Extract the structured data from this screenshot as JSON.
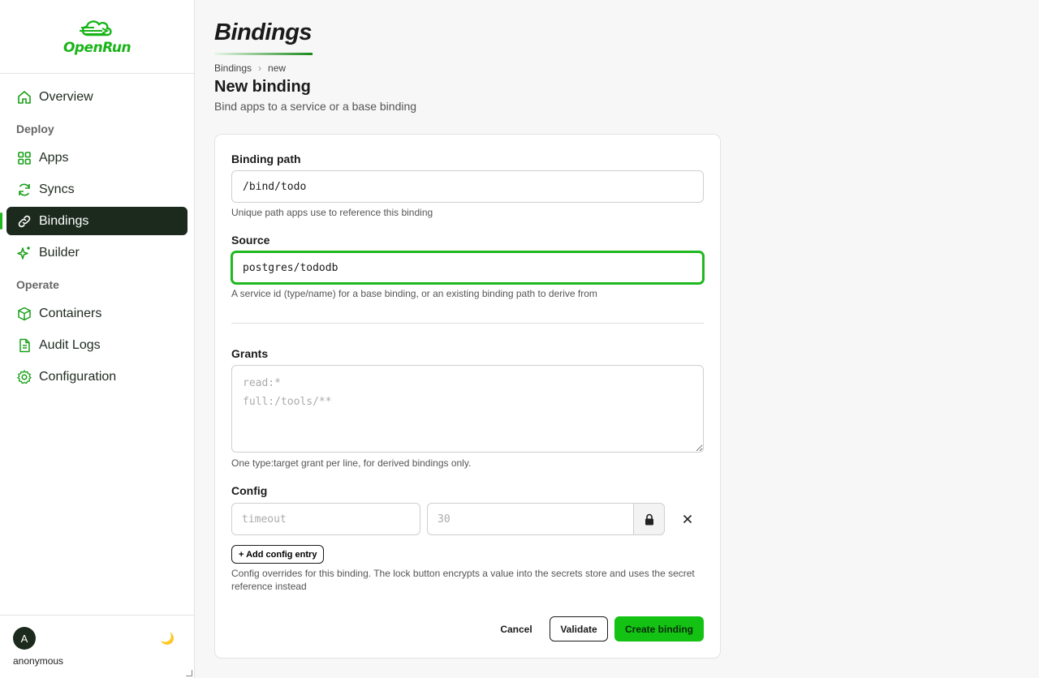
{
  "app": {
    "name": "OpenRun"
  },
  "sidebar": {
    "items": [
      {
        "label": "Overview",
        "icon": "home-icon"
      },
      {
        "section": "Deploy"
      },
      {
        "label": "Apps",
        "icon": "grid-icon"
      },
      {
        "label": "Syncs",
        "icon": "refresh-icon"
      },
      {
        "label": "Bindings",
        "icon": "link-icon",
        "active": true
      },
      {
        "label": "Builder",
        "icon": "sparkle-icon"
      },
      {
        "section": "Operate"
      },
      {
        "label": "Containers",
        "icon": "box-icon"
      },
      {
        "label": "Audit Logs",
        "icon": "file-icon"
      },
      {
        "label": "Configuration",
        "icon": "gear-icon"
      }
    ],
    "user": {
      "initial": "A",
      "name": "anonymous"
    },
    "theme_icon": "🌙"
  },
  "page": {
    "heading": "Bindings",
    "breadcrumb": [
      "Bindings",
      "new"
    ],
    "title": "New binding",
    "subtitle": "Bind apps to a service or a base binding"
  },
  "form": {
    "binding_path": {
      "label": "Binding path",
      "value": "/bind/todo",
      "hint": "Unique path apps use to reference this binding"
    },
    "source": {
      "label": "Source",
      "value": "postgres/tododb",
      "hint": "A service id (type/name) for a base binding, or an existing binding path to derive from"
    },
    "grants": {
      "label": "Grants",
      "placeholder": "read:*\nfull:/tools/**",
      "hint": "One type:target grant per line, for derived bindings only."
    },
    "config": {
      "label": "Config",
      "key_placeholder": "timeout",
      "value_placeholder": "30",
      "add_label": "+ Add config entry",
      "hint": "Config overrides for this binding. The lock button encrypts a value into the secrets store and uses the secret reference instead"
    },
    "actions": {
      "cancel": "Cancel",
      "validate": "Validate",
      "create": "Create binding"
    }
  },
  "colors": {
    "accent": "#1fb81f",
    "active_bg": "#1c2a1e"
  }
}
